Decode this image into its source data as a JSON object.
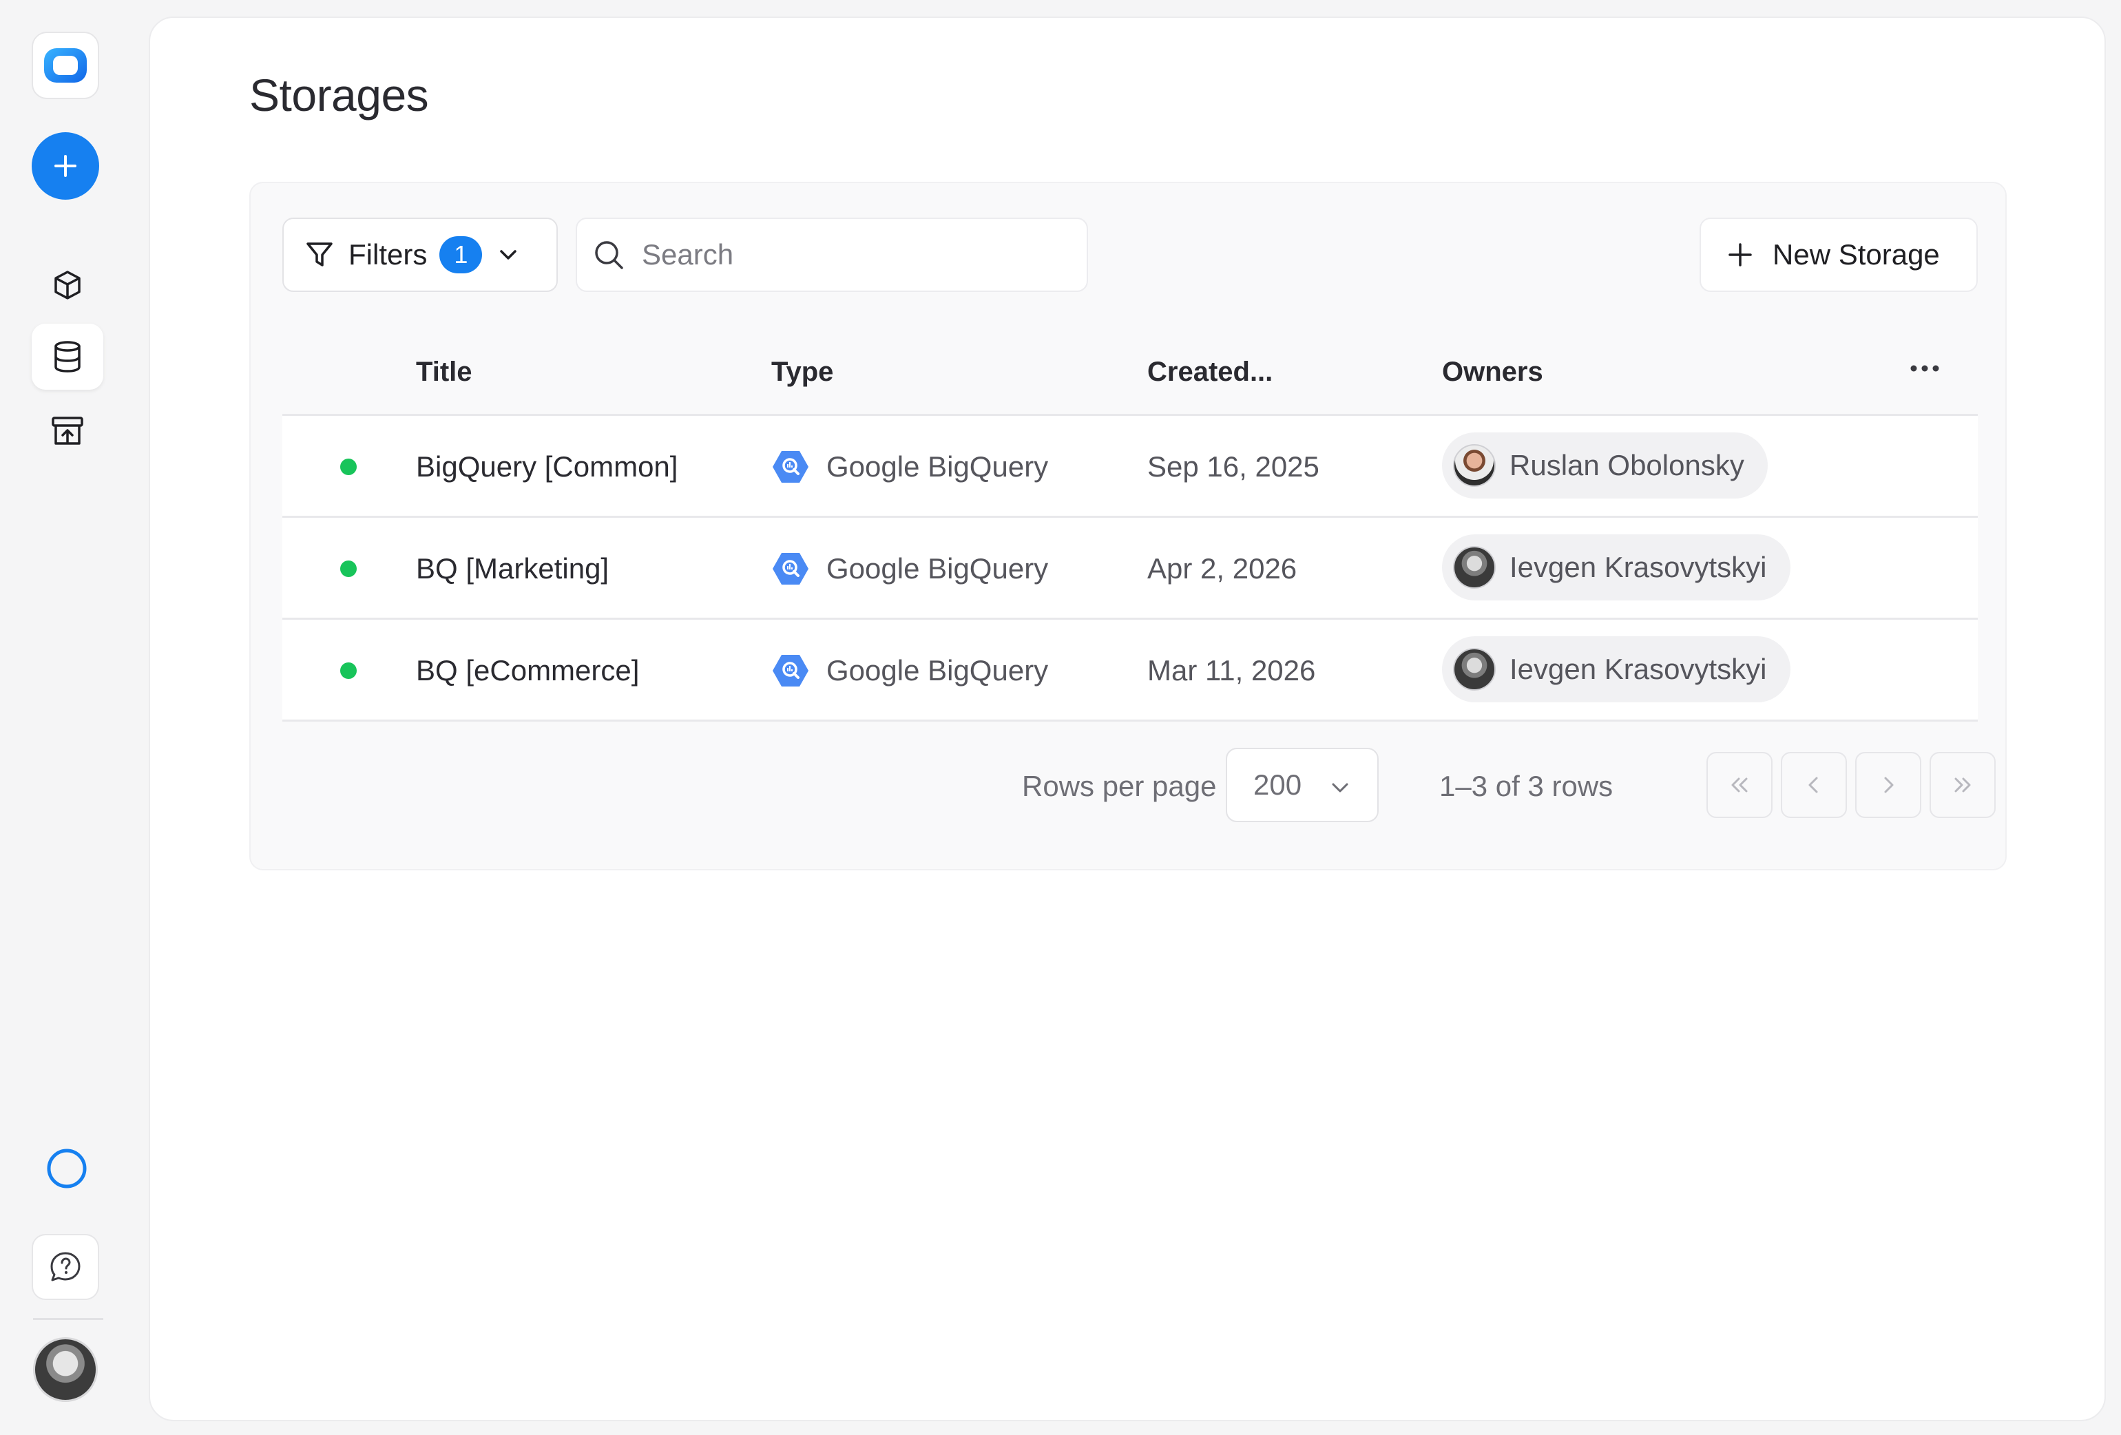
{
  "sidebar": {
    "logo_icon": "app-logo-icon",
    "add_icon": "plus-icon",
    "nav": [
      {
        "name": "models",
        "icon": "cube-icon",
        "active": false
      },
      {
        "name": "storages",
        "icon": "database-icon",
        "active": true
      },
      {
        "name": "archive",
        "icon": "archive-upload-icon",
        "active": false
      }
    ],
    "status_icon": "loading-ring-icon",
    "help_icon": "chat-help-icon",
    "avatar": "user-avatar"
  },
  "page": {
    "title": "Storages"
  },
  "toolbar": {
    "filters_label": "Filters",
    "filters_count": "1",
    "search_placeholder": "Search",
    "new_button_label": "New Storage"
  },
  "table": {
    "columns": {
      "title": "Title",
      "type": "Type",
      "created": "Created...",
      "owners": "Owners"
    },
    "rows": [
      {
        "status": "active",
        "title": "BigQuery [Common]",
        "type": "Google BigQuery",
        "created": "Sep 16, 2025",
        "owner": "Ruslan Obolonsky"
      },
      {
        "status": "active",
        "title": "BQ [Marketing]",
        "type": "Google BigQuery",
        "created": "Apr 2, 2026",
        "owner": "Ievgen Krasovytskyi"
      },
      {
        "status": "active",
        "title": "BQ [eCommerce]",
        "type": "Google BigQuery",
        "created": "Mar 11, 2026",
        "owner": "Ievgen Krasovytskyi"
      }
    ]
  },
  "pagination": {
    "rows_per_page_label": "Rows per page",
    "rows_per_page_value": "200",
    "range_text": "1–3 of 3 rows"
  },
  "colors": {
    "accent": "#1680f0",
    "status_active": "#18c45a",
    "bigquery": "#4a8af4"
  }
}
